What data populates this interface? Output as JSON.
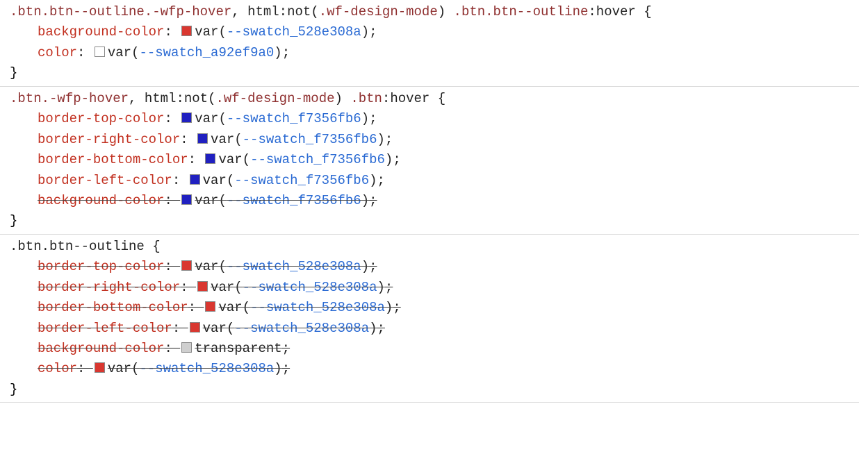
{
  "colors": {
    "red": "#d93730",
    "blue": "#2020c0",
    "white": "#ffffff",
    "lightgray": "#cfcfcf"
  },
  "rules": [
    {
      "selector_parts": [
        {
          "text": ".btn.btn--outline.-wfp-hover",
          "kind": "sel"
        },
        {
          "text": ", ",
          "kind": "punct"
        },
        {
          "text": "html:not(",
          "kind": "sel-plain"
        },
        {
          "text": ".wf-design-mode",
          "kind": "sel"
        },
        {
          "text": ") ",
          "kind": "sel-plain"
        },
        {
          "text": ".btn.btn--outline",
          "kind": "sel"
        },
        {
          "text": ":hover",
          "kind": "sel-plain"
        },
        {
          "text": " {",
          "kind": "punct"
        }
      ],
      "declarations": [
        {
          "prop": "background-color",
          "swatch": "red",
          "valuePrefix": "var(",
          "varname": "--swatch_528e308a",
          "valueSuffix": ")",
          "strike": false
        },
        {
          "prop": "color",
          "swatch": "white",
          "valuePrefix": "var(",
          "varname": "--swatch_a92ef9a0",
          "valueSuffix": ")",
          "strike": false
        }
      ]
    },
    {
      "selector_parts": [
        {
          "text": ".btn.-wfp-hover",
          "kind": "sel"
        },
        {
          "text": ", ",
          "kind": "punct"
        },
        {
          "text": "html:not(",
          "kind": "sel-plain"
        },
        {
          "text": ".wf-design-mode",
          "kind": "sel"
        },
        {
          "text": ") ",
          "kind": "sel-plain"
        },
        {
          "text": ".btn",
          "kind": "sel"
        },
        {
          "text": ":hover",
          "kind": "sel-plain"
        },
        {
          "text": " {",
          "kind": "punct"
        }
      ],
      "declarations": [
        {
          "prop": "border-top-color",
          "swatch": "blue",
          "valuePrefix": "var(",
          "varname": "--swatch_f7356fb6",
          "valueSuffix": ")",
          "strike": false
        },
        {
          "prop": "border-right-color",
          "swatch": "blue",
          "valuePrefix": "var(",
          "varname": "--swatch_f7356fb6",
          "valueSuffix": ")",
          "strike": false
        },
        {
          "prop": "border-bottom-color",
          "swatch": "blue",
          "valuePrefix": "var(",
          "varname": "--swatch_f7356fb6",
          "valueSuffix": ")",
          "strike": false
        },
        {
          "prop": "border-left-color",
          "swatch": "blue",
          "valuePrefix": "var(",
          "varname": "--swatch_f7356fb6",
          "valueSuffix": ")",
          "strike": false
        },
        {
          "prop": "background-color",
          "swatch": "blue",
          "valuePrefix": "var(",
          "varname": "--swatch_f7356fb6",
          "valueSuffix": ")",
          "strike": true
        }
      ]
    },
    {
      "selector_parts": [
        {
          "text": ".btn.btn--outline",
          "kind": "sel-plain"
        },
        {
          "text": " {",
          "kind": "punct"
        }
      ],
      "declarations": [
        {
          "prop": "border-top-color",
          "swatch": "red",
          "valuePrefix": "var(",
          "varname": "--swatch_528e308a",
          "valueSuffix": ")",
          "strike": true
        },
        {
          "prop": "border-right-color",
          "swatch": "red",
          "valuePrefix": "var(",
          "varname": "--swatch_528e308a",
          "valueSuffix": ")",
          "strike": true
        },
        {
          "prop": "border-bottom-color",
          "swatch": "red",
          "valuePrefix": "var(",
          "varname": "--swatch_528e308a",
          "valueSuffix": ")",
          "strike": true
        },
        {
          "prop": "border-left-color",
          "swatch": "red",
          "valuePrefix": "var(",
          "varname": "--swatch_528e308a",
          "valueSuffix": ")",
          "strike": true
        },
        {
          "prop": "background-color",
          "swatch": "lightgray",
          "valuePrefix": "",
          "plain": "transparent",
          "valueSuffix": "",
          "strike": true
        },
        {
          "prop": "color",
          "swatch": "red",
          "valuePrefix": "var(",
          "varname": "--swatch_528e308a",
          "valueSuffix": ")",
          "strike": true
        }
      ]
    }
  ],
  "closeBrace": "}"
}
